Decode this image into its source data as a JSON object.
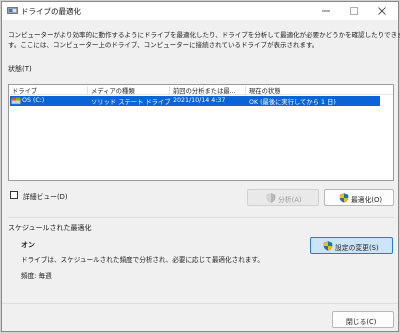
{
  "window": {
    "title": "ドライブの最適化"
  },
  "description": {
    "line1": "コンピューターがより効率的に動作するようにドライブを最適化したり、ドライブを分析して最適化が必要かどうかを確認したりできま",
    "line2": "す。ここには、コンピューター上のドライブ、コンピューターに接続されているドライブが表示されます。"
  },
  "status": {
    "label": "状態(T)",
    "columns": [
      "ドライブ",
      "メディアの種類",
      "前回の分析または最...",
      "現在の状態"
    ],
    "drives": [
      {
        "drive": "OS (C:)",
        "media_type": "ソリッド ステート ドライブ",
        "last_run": "2021/10/14 4:37",
        "current_status": "OK (最後に実行してから 1 日)",
        "icon": "drive-icon"
      }
    ]
  },
  "detail_view": {
    "label": "詳細ビュー(D)",
    "checked": false
  },
  "buttons": {
    "analyze": "分析(A)",
    "optimize": "最適化(O)",
    "change_settings": "設定の変更(S)",
    "close": "閉じる(C)"
  },
  "schedule": {
    "title": "スケジュールされた最適化",
    "state": "オン",
    "description": "ドライブは、スケジュールされた頻度で分析され、必要に応じて最適化されます。",
    "frequency": "頻度: 毎週"
  },
  "colors": {
    "selection": "#0a64d6",
    "shield_blue": "#1f6fd1",
    "shield_yellow": "#f2c200"
  }
}
